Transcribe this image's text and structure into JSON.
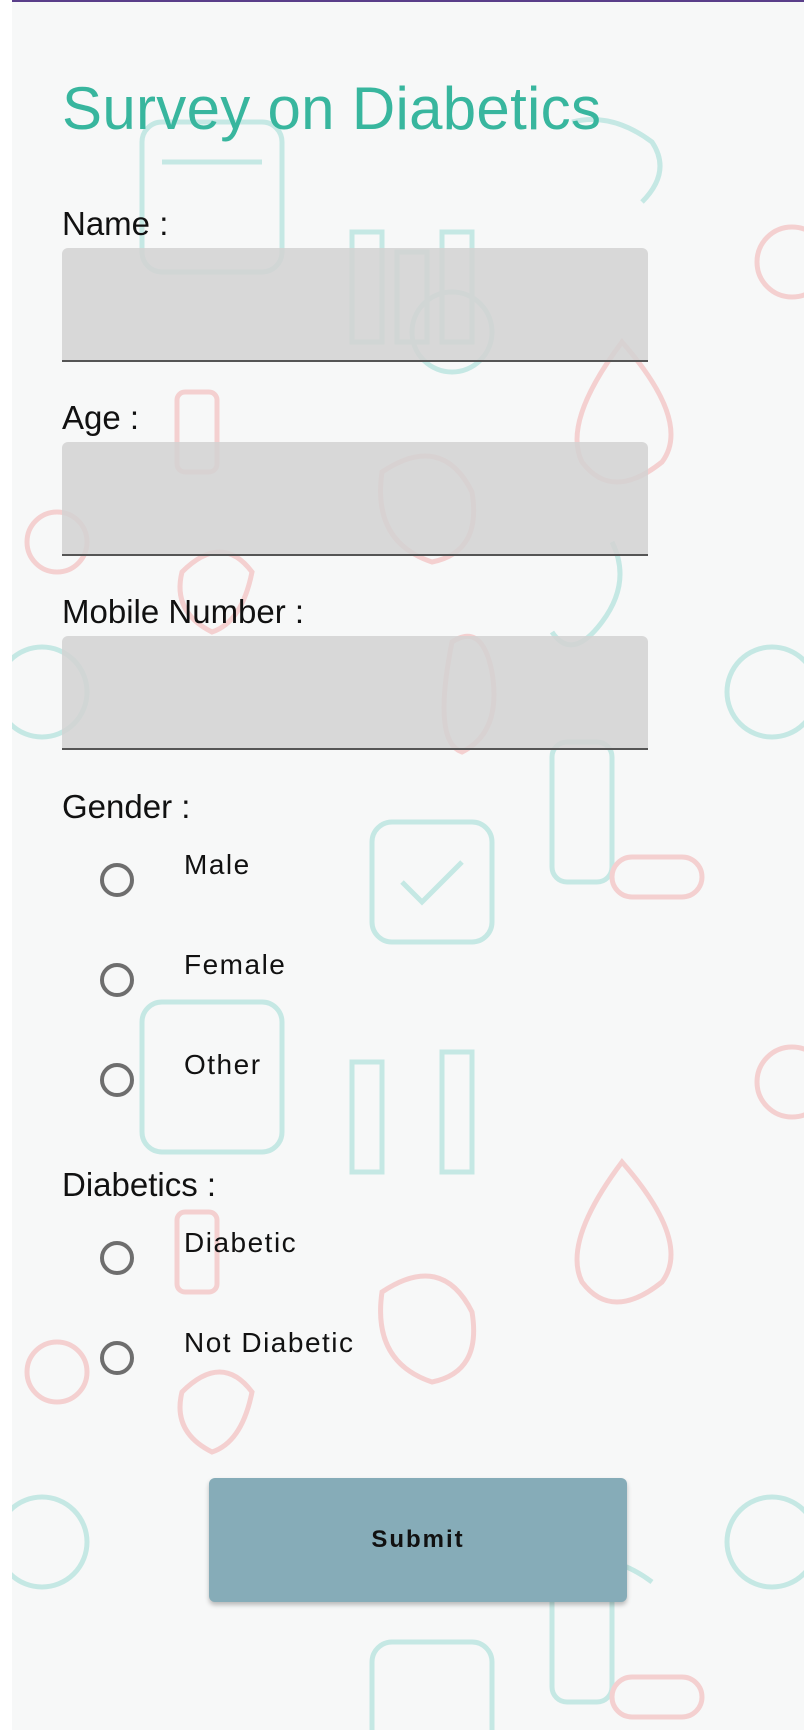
{
  "survey": {
    "title": "Survey on Diabetics",
    "name_label": "Name :",
    "name_value": "",
    "age_label": "Age :",
    "age_value": "",
    "mobile_label": "Mobile Number :",
    "mobile_value": "",
    "gender_label": "Gender :",
    "gender_options": [
      "Male",
      "Female",
      "Other"
    ],
    "diabetics_label": "Diabetics :",
    "diabetics_options": [
      "Diabetic",
      "Not Diabetic"
    ],
    "submit_label": "Submit"
  },
  "colors": {
    "title": "#38b69e",
    "submit_bg": "#86acb8",
    "pattern_teal": "#8fd6cf",
    "pattern_red": "#f2a9a9"
  }
}
